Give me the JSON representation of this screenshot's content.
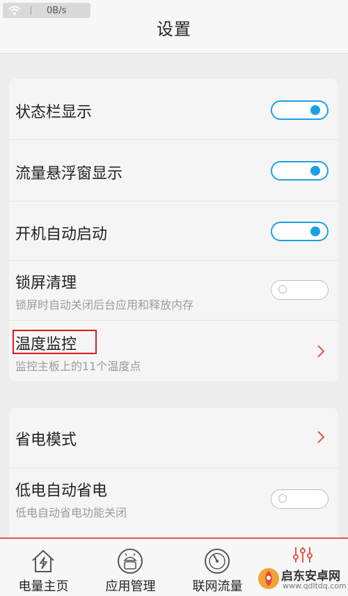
{
  "status": {
    "speed": "0B/s"
  },
  "header": {
    "title": "设置"
  },
  "card1": [
    {
      "label": "状态栏显示",
      "toggle": "on"
    },
    {
      "label": "流量悬浮窗显示",
      "toggle": "on"
    },
    {
      "label": "开机自动启动",
      "toggle": "on"
    },
    {
      "label": "锁屏清理",
      "sub": "锁屏时自动关闭后台应用和释放内存",
      "toggle": "off"
    },
    {
      "label": "温度监控",
      "sub": "监控主板上的11个温度点",
      "chevron": true
    }
  ],
  "card2": [
    {
      "label": "省电模式",
      "chevron": true
    },
    {
      "label": "低电自动省电",
      "sub": "低电自动省电功能关闭",
      "toggle": "off"
    }
  ],
  "tabs": [
    {
      "label": "电量主页",
      "icon": "battery-house-icon"
    },
    {
      "label": "应用管理",
      "icon": "android-icon"
    },
    {
      "label": "联网流量",
      "icon": "speedometer-icon"
    },
    {
      "label": "",
      "icon": "settings-sliders-icon",
      "active": true
    }
  ],
  "watermark": {
    "line1": "启东安卓网",
    "line2": "www.qdltdq.com"
  },
  "colors": {
    "accent": "#1ba0e6",
    "tab_active": "#e0584c",
    "highlight": "#e01a1a"
  }
}
